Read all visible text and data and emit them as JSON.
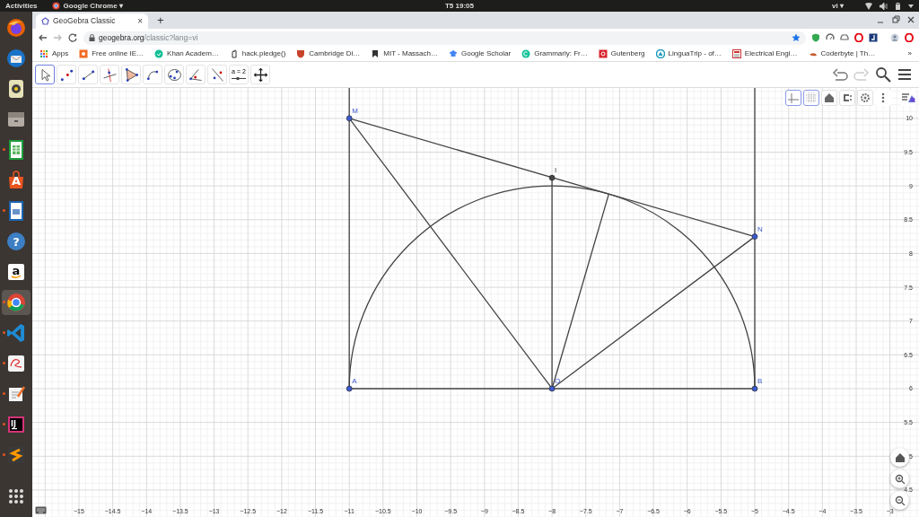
{
  "top_bar": {
    "activities": "Activities",
    "app_menu": "Google Chrome ▾",
    "clock": "T5 19:05",
    "language": "vi ▾"
  },
  "dock": [
    {
      "selected": false,
      "running": false
    },
    {
      "selected": false,
      "running": false
    },
    {
      "selected": false,
      "running": false
    },
    {
      "selected": false,
      "running": false
    },
    {
      "selected": false,
      "running": true
    },
    {
      "selected": false,
      "running": false,
      "glyph": "A"
    },
    {
      "selected": false,
      "running": true
    },
    {
      "selected": false,
      "running": false,
      "glyph": "?"
    },
    {
      "selected": false,
      "running": false,
      "glyph": "a"
    },
    {
      "selected": true,
      "running": true
    },
    {
      "selected": false,
      "running": true
    },
    {
      "selected": false,
      "running": true
    },
    {
      "selected": false,
      "running": true
    },
    {
      "selected": false,
      "running": true,
      "glyph": "IJ"
    },
    {
      "selected": false,
      "running": true
    },
    {
      "selected": false,
      "running": false
    }
  ],
  "browser": {
    "tab": {
      "title": "GeoGebra Classic",
      "close": "×"
    },
    "new_tab": "+",
    "address": {
      "host": "geogebra.org",
      "path": "/classic?lang=vi"
    },
    "bookmarks": [
      {
        "label": "Apps"
      },
      {
        "label": "Free online IE…"
      },
      {
        "label": "Khan Academ…"
      },
      {
        "label": "hack.pledge()"
      },
      {
        "label": "Cambridge Di…"
      },
      {
        "label": "MIT - Massach…"
      },
      {
        "label": "Google Scholar"
      },
      {
        "label": "Grammarly: Fr…"
      },
      {
        "label": "Gutenberg"
      },
      {
        "label": "LinguaTrip - of…"
      },
      {
        "label": "Electrical Engi…"
      },
      {
        "label": "Coderbyte | Th…"
      }
    ],
    "bookmarks_more": "»"
  },
  "tools": [
    {
      "selected": true
    },
    {
      "selected": false
    },
    {
      "selected": false
    },
    {
      "selected": false
    },
    {
      "selected": false
    },
    {
      "selected": false
    },
    {
      "selected": false
    },
    {
      "selected": false
    },
    {
      "selected": false
    },
    {
      "selected": false,
      "label": "a = 2"
    },
    {
      "selected": false
    }
  ],
  "style_bar": {
    "axes_shown": true,
    "grid_shown": true
  },
  "graphics": {
    "chart_data": {
      "type": "scatter",
      "grid": true,
      "xlim": [
        -15.69,
        -2.57
      ],
      "ylim": [
        4.1,
        10.45
      ],
      "xticks": [
        {
          "value": -15,
          "label": "−15"
        },
        {
          "value": -14.5,
          "label": "−14.5"
        },
        {
          "value": -14,
          "label": "−14"
        },
        {
          "value": -13.5,
          "label": "−13.5"
        },
        {
          "value": -13,
          "label": "−13"
        },
        {
          "value": -12.5,
          "label": "−12.5"
        },
        {
          "value": -12,
          "label": "−12"
        },
        {
          "value": -11.5,
          "label": "−11.5"
        },
        {
          "value": -11,
          "label": "−11"
        },
        {
          "value": -10.5,
          "label": "−10.5"
        },
        {
          "value": -10,
          "label": "−10"
        },
        {
          "value": -9.5,
          "label": "−9.5"
        },
        {
          "value": -9,
          "label": "−9"
        },
        {
          "value": -8.5,
          "label": "−8.5"
        },
        {
          "value": -8,
          "label": "−8"
        },
        {
          "value": -7.5,
          "label": "−7.5"
        },
        {
          "value": -7,
          "label": "−7"
        },
        {
          "value": -6.5,
          "label": "−6.5"
        },
        {
          "value": -6,
          "label": "−6"
        },
        {
          "value": -5.5,
          "label": "−5.5"
        },
        {
          "value": -5,
          "label": "−5"
        },
        {
          "value": -4.5,
          "label": "−4.5"
        },
        {
          "value": -4,
          "label": "−4"
        },
        {
          "value": -3.5,
          "label": "−3.5"
        },
        {
          "value": -3,
          "label": "−3"
        }
      ],
      "yticks": [
        10,
        9.5,
        9,
        8.5,
        8,
        7.5,
        7,
        6.5,
        6,
        5.5,
        5,
        4.5
      ],
      "series": [
        {
          "name": "M",
          "color": "#3d5acc",
          "x": [
            -11
          ],
          "values": [
            10
          ]
        },
        {
          "name": "I",
          "color": "#444444",
          "x": [
            -8
          ],
          "values": [
            9.12
          ]
        },
        {
          "name": "N",
          "color": "#3d5acc",
          "x": [
            -5
          ],
          "values": [
            8.25
          ]
        },
        {
          "name": "A",
          "color": "#3d5acc",
          "x": [
            -11
          ],
          "values": [
            6
          ]
        },
        {
          "name": "O",
          "color": "#3d5acc",
          "x": [
            -8
          ],
          "values": [
            6
          ]
        },
        {
          "name": "B",
          "color": "#3d5acc",
          "x": [
            -5
          ],
          "values": [
            6
          ]
        }
      ]
    }
  }
}
